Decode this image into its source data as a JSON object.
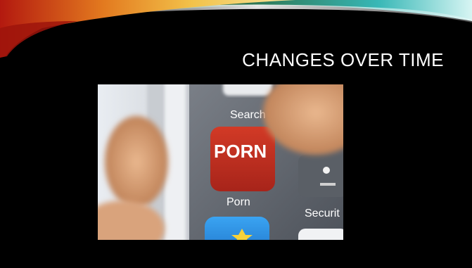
{
  "slide": {
    "title": "CHANGES OVER TIME"
  },
  "photo": {
    "apps": {
      "search_label": "Search",
      "porn_icon_text": "PORN",
      "porn_label": "Porn",
      "security_label": "Securit"
    }
  },
  "colors": {
    "background": "#000000",
    "title_text": "#ffffff",
    "swoosh_orange": "#e07a1f",
    "swoosh_red": "#c0261a",
    "swoosh_green": "#2f6b3a",
    "swoosh_teal": "#3ec7c9",
    "porn_icon_red": "#c8311f"
  }
}
